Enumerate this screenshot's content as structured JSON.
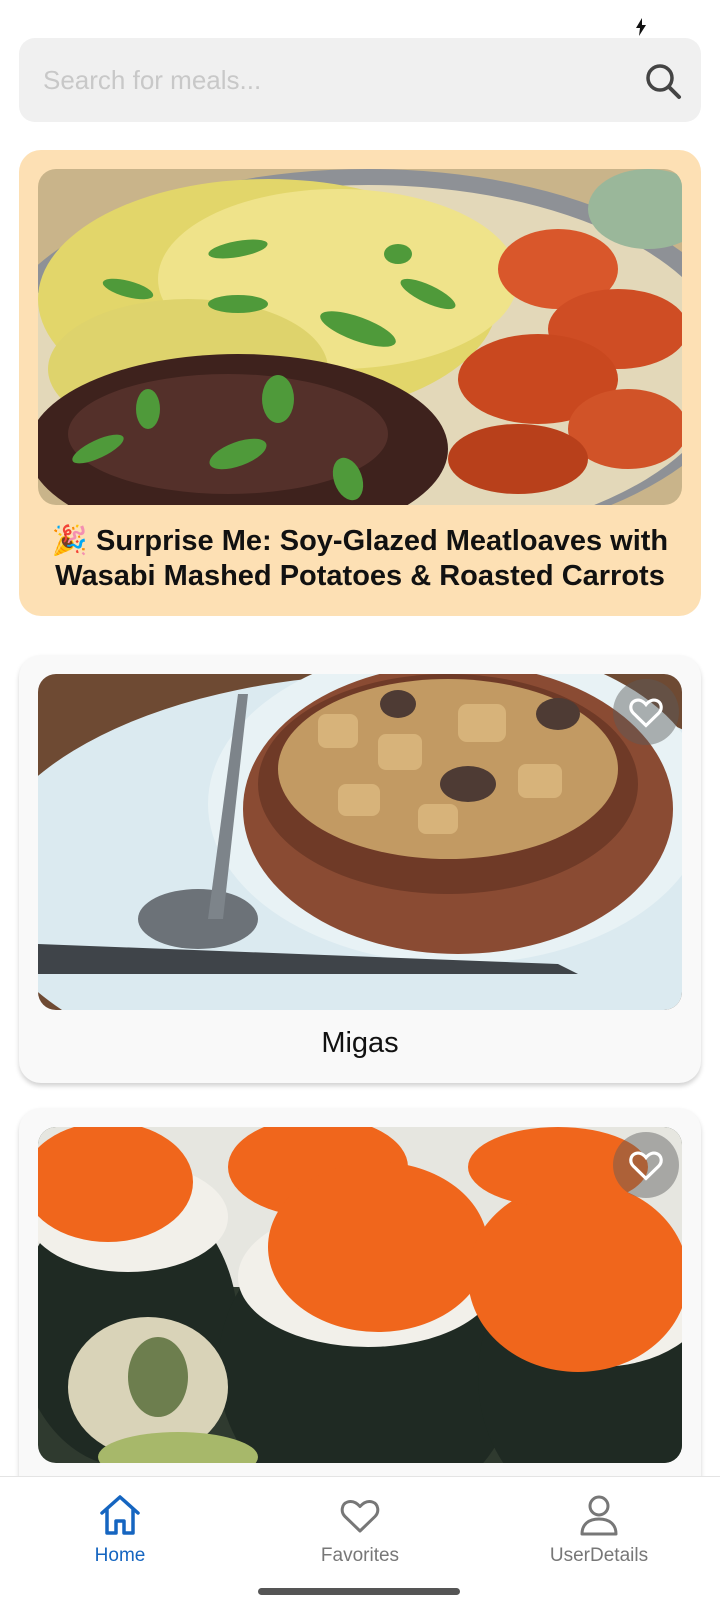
{
  "search": {
    "placeholder": "Search for meals..."
  },
  "surprise": {
    "title": "🎉 Surprise Me: Soy-Glazed Meatloaves with Wasabi Mashed Potatoes & Roasted Carrots"
  },
  "meals": [
    {
      "title": "Migas",
      "favorite": false,
      "icon": "heart-outline-icon"
    },
    {
      "title": "",
      "favorite": false,
      "icon": "heart-outline-icon"
    }
  ],
  "nav": {
    "items": [
      {
        "label": "Home",
        "icon": "home-icon",
        "active": true
      },
      {
        "label": "Favorites",
        "icon": "heart-icon",
        "active": false
      },
      {
        "label": "UserDetails",
        "icon": "user-icon",
        "active": false
      }
    ]
  },
  "colors": {
    "accent": "#1565c0",
    "surprise_card": "#fde0b4",
    "inactive_nav": "#777777"
  }
}
